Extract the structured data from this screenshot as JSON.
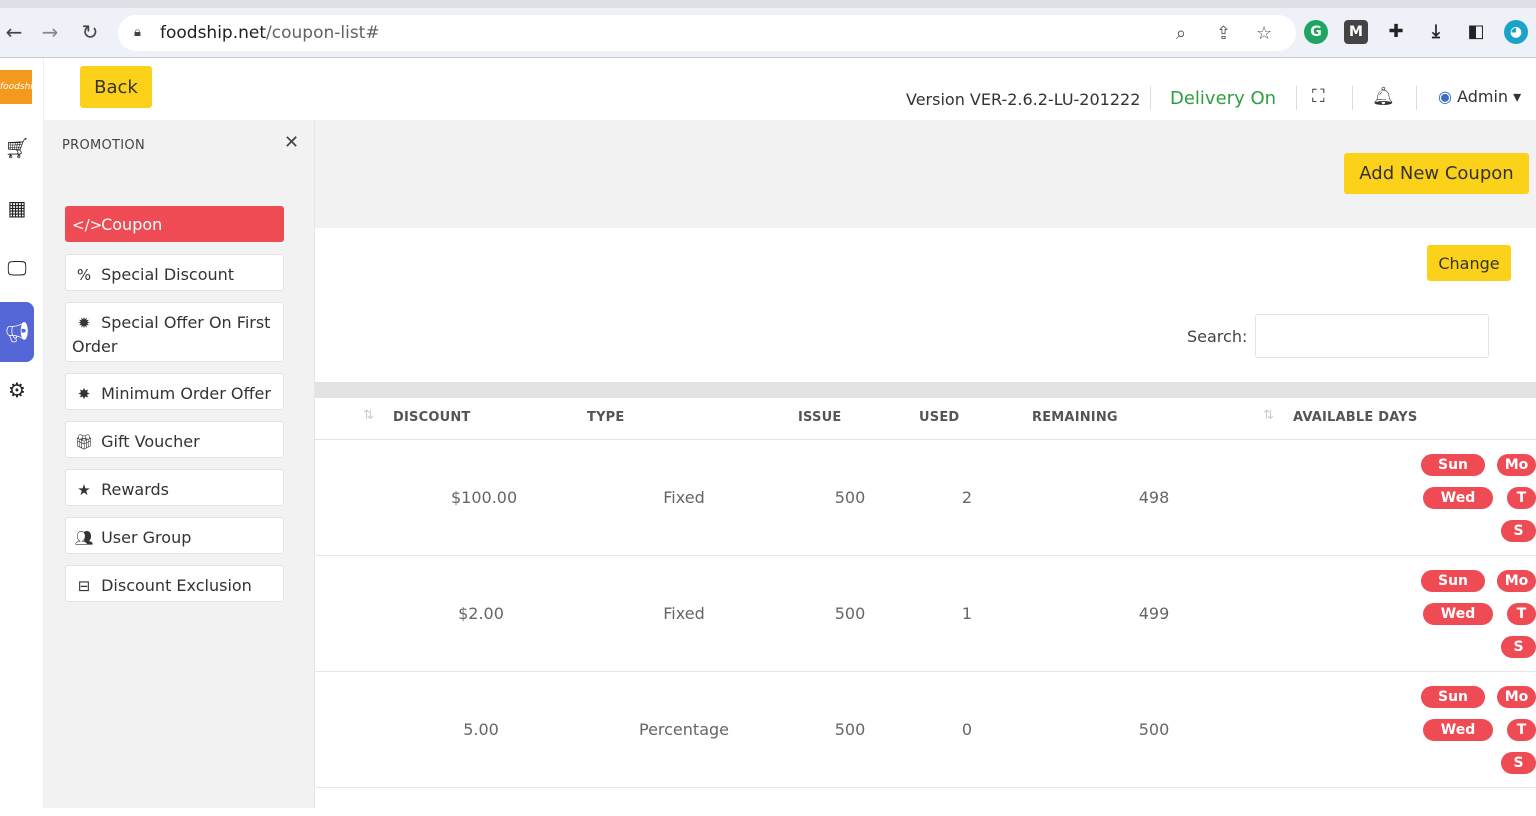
{
  "browser": {
    "url_host": "foodship.net",
    "url_path": "/coupon-list#"
  },
  "topbar": {
    "back_label": "Back",
    "version": "Version VER-2.6.2-LU-201222",
    "delivery": "Delivery On",
    "admin": "Admin"
  },
  "sidebar": {
    "title": "PROMOTION",
    "items": [
      {
        "label": "Coupon",
        "icon": "code-icon"
      },
      {
        "label": "Special Discount",
        "icon": "percent-icon"
      },
      {
        "label": "Special Offer On First Order",
        "icon": "badge-icon"
      },
      {
        "label": "Minimum Order Offer",
        "icon": "star-badge-icon"
      },
      {
        "label": "Gift Voucher",
        "icon": "gift-icon"
      },
      {
        "label": "Rewards",
        "icon": "star-icon"
      },
      {
        "label": "User Group",
        "icon": "users-icon"
      },
      {
        "label": "Discount Exclusion",
        "icon": "minus-square-icon"
      }
    ]
  },
  "main": {
    "add_button": "Add New Coupon",
    "change_button": "Change",
    "search_label": "Search:",
    "columns": [
      "DISCOUNT",
      "TYPE",
      "ISSUE",
      "USED",
      "REMAINING",
      "AVAILABLE DAYS"
    ],
    "rows": [
      {
        "discount": "$100.00",
        "type": "Fixed",
        "issue": "500",
        "used": "2",
        "remaining": "498",
        "days": [
          "Sun",
          "Mo",
          "Wed",
          "T",
          "S"
        ]
      },
      {
        "discount": "$2.00",
        "type": "Fixed",
        "issue": "500",
        "used": "1",
        "remaining": "499",
        "days": [
          "Sun",
          "Mo",
          "Wed",
          "T",
          "S"
        ]
      },
      {
        "discount": "5.00",
        "type": "Percentage",
        "issue": "500",
        "used": "0",
        "remaining": "500",
        "days": [
          "Sun",
          "Mo",
          "Wed",
          "T",
          "S"
        ]
      }
    ]
  },
  "colors": {
    "accent_yellow": "#fcd11a",
    "active_red": "#ee4b55",
    "delivery_green": "#2e9e3e",
    "rail_active": "#5567d6"
  }
}
